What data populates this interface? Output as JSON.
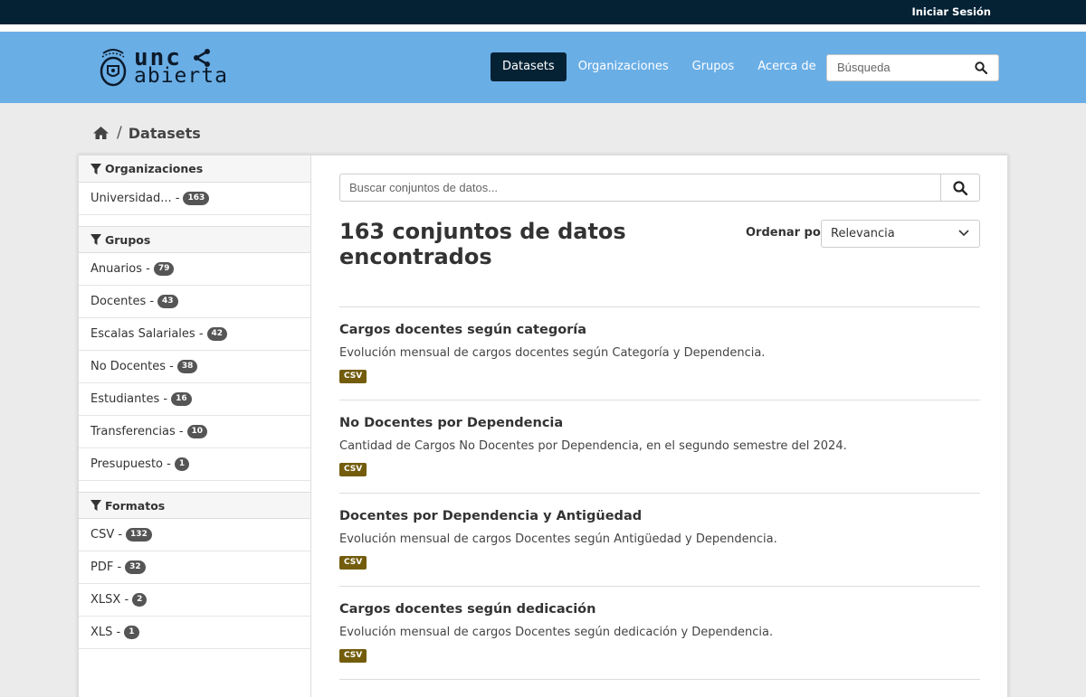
{
  "topbar": {
    "login": "Iniciar Sesión"
  },
  "logo": {
    "line1": "unc",
    "line2": "abierta"
  },
  "nav": {
    "items": [
      "Datasets",
      "Organizaciones",
      "Grupos",
      "Acerca de"
    ],
    "active": "Datasets"
  },
  "site_search": {
    "placeholder": "Búsqueda"
  },
  "breadcrumb": {
    "current": "Datasets"
  },
  "facets": {
    "organizaciones": {
      "title": "Organizaciones",
      "items": [
        {
          "label": "Universidad... -",
          "count": "163"
        }
      ]
    },
    "grupos": {
      "title": "Grupos",
      "items": [
        {
          "label": "Anuarios -",
          "count": "79"
        },
        {
          "label": "Docentes -",
          "count": "43"
        },
        {
          "label": "Escalas Salariales -",
          "count": "42"
        },
        {
          "label": "No Docentes -",
          "count": "38"
        },
        {
          "label": "Estudiantes -",
          "count": "16"
        },
        {
          "label": "Transferencias -",
          "count": "10"
        },
        {
          "label": "Presupuesto -",
          "count": "1"
        }
      ]
    },
    "formatos": {
      "title": "Formatos",
      "items": [
        {
          "label": "CSV -",
          "count": "132"
        },
        {
          "label": "PDF -",
          "count": "32"
        },
        {
          "label": "XLSX -",
          "count": "2"
        },
        {
          "label": "XLS -",
          "count": "1"
        }
      ]
    }
  },
  "dataset_search": {
    "placeholder": "Buscar conjuntos de datos..."
  },
  "results": {
    "count_title": "163 conjuntos de datos encontrados",
    "order_label": "Ordenar por:",
    "order_value": "Relevancia",
    "items": [
      {
        "title": "Cargos docentes según categoría",
        "description": "Evolución mensual de cargos docentes según Categoría y Dependencia.",
        "format": "CSV"
      },
      {
        "title": "No Docentes por Dependencia",
        "description": "Cantidad de Cargos No Docentes por Dependencia, en el segundo semestre del 2024.",
        "format": "CSV"
      },
      {
        "title": "Docentes por Dependencia y Antigüedad",
        "description": "Evolución mensual de cargos Docentes según Antigüedad y Dependencia.",
        "format": "CSV"
      },
      {
        "title": "Cargos docentes según dedicación",
        "description": "Evolución mensual de cargos Docentes según dedicación y Dependencia.",
        "format": "CSV"
      }
    ]
  },
  "colors": {
    "topbar": "#052235",
    "masthead": "#6aaee6",
    "nav_active": "#052235",
    "format_badge": "#735d0d",
    "count_badge": "#555555"
  }
}
